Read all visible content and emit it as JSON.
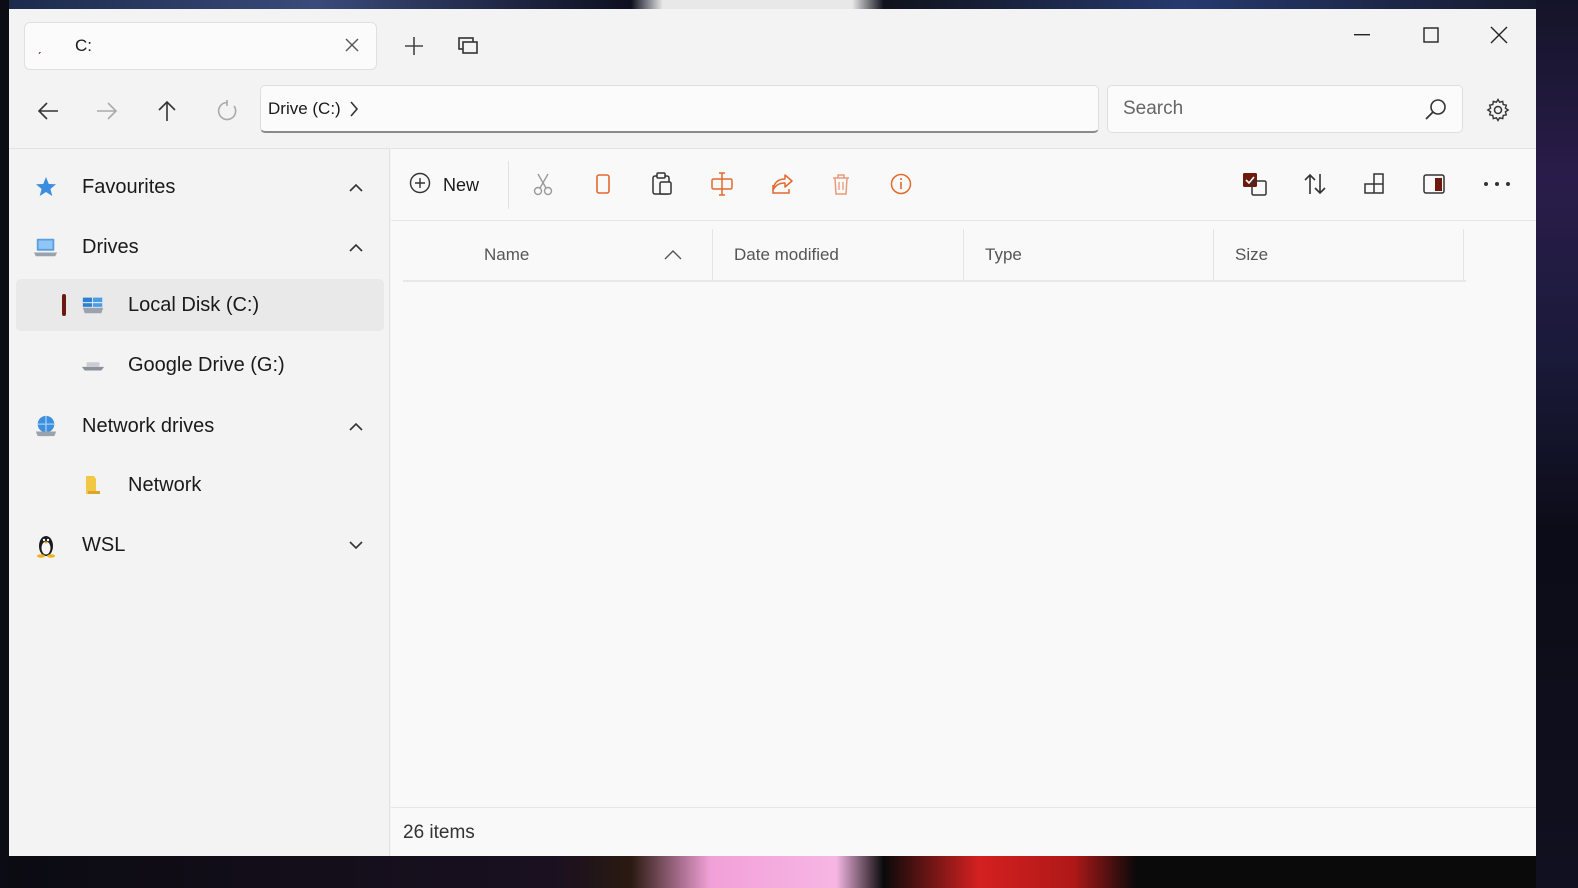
{
  "tab": {
    "title": "C:"
  },
  "window_controls": {
    "minimize": "minimize",
    "maximize": "maximize",
    "close": "close"
  },
  "address": {
    "crumb": "Drive (C:)"
  },
  "search": {
    "placeholder": "Search"
  },
  "sidebar": {
    "items": [
      {
        "label": "Favourites",
        "icon": "star-icon",
        "expanded": true
      },
      {
        "label": "Drives",
        "icon": "drive-icon",
        "expanded": true
      },
      {
        "label": "Local Disk (C:)",
        "icon": "local-disk-icon",
        "selected": true
      },
      {
        "label": "Google Drive (G:)",
        "icon": "google-drive-icon"
      },
      {
        "label": "Network drives",
        "icon": "network-drive-icon",
        "expanded": true
      },
      {
        "label": "Network",
        "icon": "folder-icon"
      },
      {
        "label": "WSL",
        "icon": "linux-penguin-icon",
        "expanded": false
      }
    ]
  },
  "toolbar": {
    "new_label": "New",
    "tools": [
      "cut-icon",
      "copy-icon",
      "paste-icon",
      "rename-icon",
      "share-icon",
      "delete-icon",
      "properties-icon"
    ],
    "right_tools": [
      "select-icon",
      "sort-icon",
      "layout-icon",
      "preview-pane-icon",
      "more-icon"
    ]
  },
  "columns": [
    "Name",
    "Date modified",
    "Type",
    "Size"
  ],
  "status": {
    "items": "26 items"
  },
  "colors": {
    "accent": "#6b1a0c",
    "icon_orange": "#e87a50",
    "background": "#f3f3f3"
  }
}
